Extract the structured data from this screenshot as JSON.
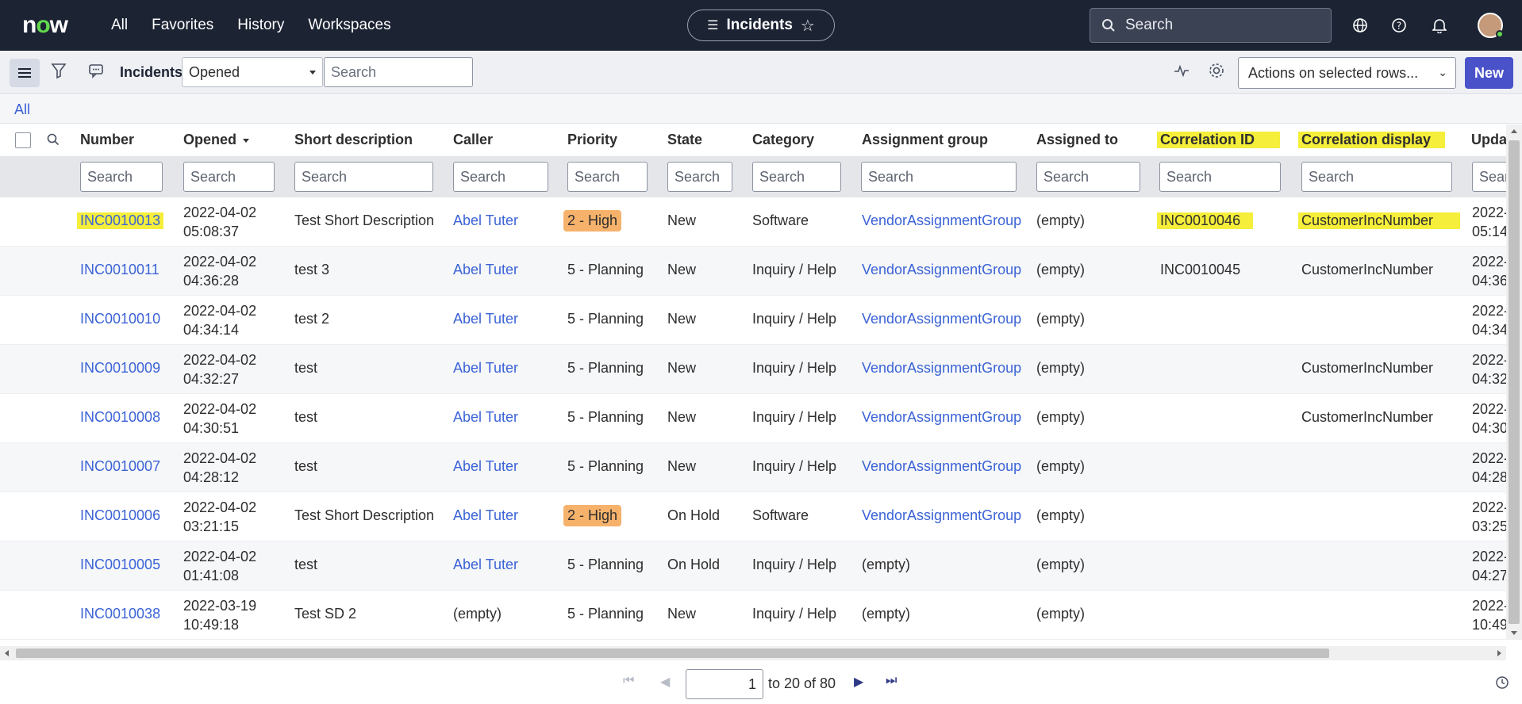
{
  "topnav": {
    "logo": "now",
    "items": [
      "All",
      "Favorites",
      "History",
      "Workspaces"
    ],
    "context_title": "Incidents",
    "search_placeholder": "Search"
  },
  "toolbar": {
    "title": "Incidents",
    "filter_field": "Opened",
    "search_placeholder": "Search",
    "actions_label": "Actions on selected rows...",
    "new_label": "New"
  },
  "breadcrumb": {
    "all": "All"
  },
  "columns": [
    "Number",
    "Opened",
    "Short description",
    "Caller",
    "Priority",
    "State",
    "Category",
    "Assignment group",
    "Assigned to",
    "Correlation ID",
    "Correlation display",
    "Updat"
  ],
  "column_search_placeholders": [
    "Search",
    "Search",
    "Search",
    "Search",
    "Search",
    "Search",
    "Search",
    "Search",
    "Search",
    "Search",
    "Search",
    "Sear"
  ],
  "rows": [
    {
      "number": "INC0010013",
      "opened_date": "2022-04-02",
      "opened_time": "05:08:37",
      "short_description": "Test Short Description",
      "caller": "Abel Tuter",
      "priority": "2 - High",
      "state": "New",
      "category": "Software",
      "assignment_group": "VendorAssignmentGroup",
      "assigned_to": "(empty)",
      "correlation_id": "INC0010046",
      "correlation_display": "CustomerIncNumber",
      "updated_date": "2022-",
      "updated_time": "05:14"
    },
    {
      "number": "INC0010011",
      "opened_date": "2022-04-02",
      "opened_time": "04:36:28",
      "short_description": "test 3",
      "caller": "Abel Tuter",
      "priority": "5 - Planning",
      "state": "New",
      "category": "Inquiry / Help",
      "assignment_group": "VendorAssignmentGroup",
      "assigned_to": "(empty)",
      "correlation_id": "INC0010045",
      "correlation_display": "CustomerIncNumber",
      "updated_date": "2022-",
      "updated_time": "04:36"
    },
    {
      "number": "INC0010010",
      "opened_date": "2022-04-02",
      "opened_time": "04:34:14",
      "short_description": "test 2",
      "caller": "Abel Tuter",
      "priority": "5 - Planning",
      "state": "New",
      "category": "Inquiry / Help",
      "assignment_group": "VendorAssignmentGroup",
      "assigned_to": "(empty)",
      "correlation_id": "",
      "correlation_display": "",
      "updated_date": "2022-",
      "updated_time": "04:34"
    },
    {
      "number": "INC0010009",
      "opened_date": "2022-04-02",
      "opened_time": "04:32:27",
      "short_description": "test",
      "caller": "Abel Tuter",
      "priority": "5 - Planning",
      "state": "New",
      "category": "Inquiry / Help",
      "assignment_group": "VendorAssignmentGroup",
      "assigned_to": "(empty)",
      "correlation_id": "",
      "correlation_display": "CustomerIncNumber",
      "updated_date": "2022-",
      "updated_time": "04:32"
    },
    {
      "number": "INC0010008",
      "opened_date": "2022-04-02",
      "opened_time": "04:30:51",
      "short_description": "test",
      "caller": "Abel Tuter",
      "priority": "5 - Planning",
      "state": "New",
      "category": "Inquiry / Help",
      "assignment_group": "VendorAssignmentGroup",
      "assigned_to": "(empty)",
      "correlation_id": "",
      "correlation_display": "CustomerIncNumber",
      "updated_date": "2022-",
      "updated_time": "04:30"
    },
    {
      "number": "INC0010007",
      "opened_date": "2022-04-02",
      "opened_time": "04:28:12",
      "short_description": "test",
      "caller": "Abel Tuter",
      "priority": "5 - Planning",
      "state": "New",
      "category": "Inquiry / Help",
      "assignment_group": "VendorAssignmentGroup",
      "assigned_to": "(empty)",
      "correlation_id": "",
      "correlation_display": "",
      "updated_date": "2022-",
      "updated_time": "04:28"
    },
    {
      "number": "INC0010006",
      "opened_date": "2022-04-02",
      "opened_time": "03:21:15",
      "short_description": "Test Short Description",
      "caller": "Abel Tuter",
      "priority": "2 - High",
      "state": "On Hold",
      "category": "Software",
      "assignment_group": "VendorAssignmentGroup",
      "assigned_to": "(empty)",
      "correlation_id": "",
      "correlation_display": "",
      "updated_date": "2022-",
      "updated_time": "03:25"
    },
    {
      "number": "INC0010005",
      "opened_date": "2022-04-02",
      "opened_time": "01:41:08",
      "short_description": "test",
      "caller": "Abel Tuter",
      "priority": "5 - Planning",
      "state": "On Hold",
      "category": "Inquiry / Help",
      "assignment_group": "(empty)",
      "assigned_to": "(empty)",
      "correlation_id": "",
      "correlation_display": "",
      "updated_date": "2022-",
      "updated_time": "04:27"
    },
    {
      "number": "INC0010038",
      "opened_date": "2022-03-19",
      "opened_time": "10:49:18",
      "short_description": "Test SD 2",
      "caller": "(empty)",
      "priority": "5 - Planning",
      "state": "New",
      "category": "Inquiry / Help",
      "assignment_group": "(empty)",
      "assigned_to": "(empty)",
      "correlation_id": "",
      "correlation_display": "",
      "updated_date": "2022-",
      "updated_time": "10:49"
    }
  ],
  "pager": {
    "page_value": "1",
    "range_text": "to 20 of 80"
  },
  "colors": {
    "nav_bg": "#1c2333",
    "link": "#3b63d6",
    "highlight": "#f5ee3a",
    "priority_high": "#f6b26b",
    "new_button": "#4a52c9"
  }
}
